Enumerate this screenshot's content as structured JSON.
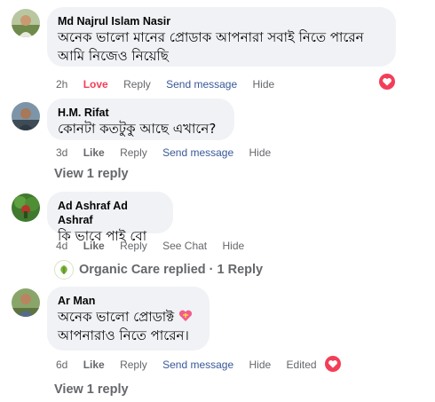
{
  "comments": [
    {
      "author": "Md Najrul Islam Nasir",
      "text_line1": "অনেক ভালো মানের প্রোডাক আপনারা সবাই নিতে পারেন",
      "text_line2": "আমি নিজেও নিয়েছি",
      "time": "2h",
      "love": "Love",
      "reply": "Reply",
      "send_message": "Send message",
      "hide": "Hide",
      "reaction_icon": "heart-icon"
    },
    {
      "author": "H.M. Rifat",
      "text": "কোনটা কতটুকু আছে এখানে?",
      "time": "3d",
      "like": "Like",
      "reply": "Reply",
      "send_message": "Send message",
      "hide": "Hide",
      "view_replies": "View 1 reply"
    },
    {
      "author": "Ad Ashraf Ad Ashraf",
      "text": "কি ভাবে পাই বো",
      "time": "4d",
      "like": "Like",
      "reply": "Reply",
      "see_chat": "See Chat",
      "hide": "Hide",
      "replied_summary": "Organic Care replied · 1 Reply"
    },
    {
      "author": "Ar Man",
      "text_line1": "অনেক ভালো প্রোডাক্ট",
      "text_line2": "আপনারাও নিতে পারেন।",
      "emoji": "heart-with-ribbon-icon",
      "time": "6d",
      "like": "Like",
      "reply": "Reply",
      "send_message": "Send message",
      "hide": "Hide",
      "edited": "Edited",
      "reaction_icon": "heart-icon",
      "view_replies": "View 1 reply"
    }
  ],
  "colors": {
    "bubble": "#f0f2f5",
    "secondary_text": "#65676b",
    "love": "#f33e58",
    "link": "#385898"
  }
}
